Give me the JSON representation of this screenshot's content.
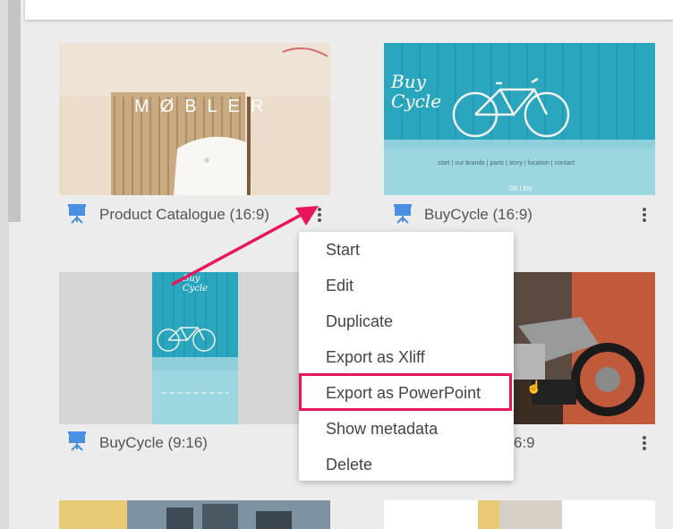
{
  "cards": [
    {
      "label": "Product Catalogue (16:9)",
      "thumb_text": "MØBLER"
    },
    {
      "label": "BuyCycle (16:9)",
      "thumb_logo": "Buy Cycle",
      "thumb_nav": "start  |  our brands  |  parts  |  story  |  location  |  contact",
      "thumb_lang": "DE | EN"
    },
    {
      "label": "BuyCycle (9:16)",
      "thumb_logo": "Buy Cycle"
    },
    {
      "label": "6:9"
    }
  ],
  "context_menu": {
    "items": [
      {
        "label": "Start"
      },
      {
        "label": "Edit"
      },
      {
        "label": "Duplicate"
      },
      {
        "label": "Export as Xliff"
      },
      {
        "label": "Export as PowerPoint"
      },
      {
        "label": "Show metadata"
      },
      {
        "label": "Delete"
      }
    ],
    "highlighted": "Export as PowerPoint"
  },
  "colors": {
    "accent_highlight": "#e8175d",
    "presentation_icon": "#4a90e2",
    "teal": "#2aa6be"
  },
  "icons": {
    "presentation": "presentation-icon",
    "more": "more-vertical-icon",
    "arrow": "annotation-arrow-icon"
  }
}
